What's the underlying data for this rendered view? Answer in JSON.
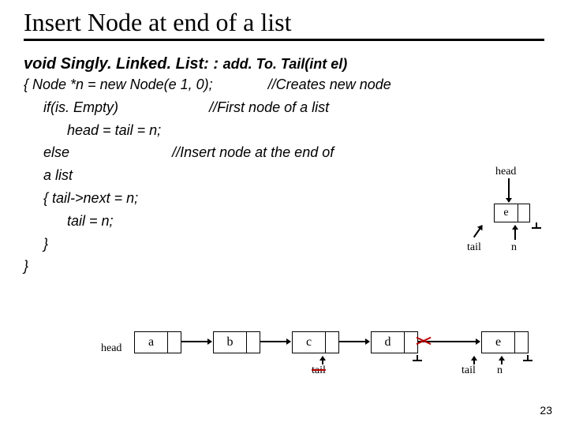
{
  "title": "Insert Node at end of a list",
  "signature": {
    "ret": "void ",
    "cls": "Singly. Linked. List: : ",
    "method": "add. To. Tail(int el)"
  },
  "lines": {
    "l1a": "{   Node *n = new Node(e 1, 0);",
    "l1b": "//Creates new node",
    "l2a": "if(is. Empty)",
    "l2b": "//First node of a list",
    "l3": "head = tail = n;",
    "l4a": "else",
    "l4b": "//Insert node at the end of",
    "l4c": "a list",
    "l5": "{    tail->next = n;",
    "l6": "tail = n;",
    "l7": "}",
    "l8": "}"
  },
  "dia1": {
    "head": "head",
    "val": "e",
    "tail": "tail",
    "n": "n"
  },
  "dia2": {
    "head": "head",
    "vals": [
      "a",
      "b",
      "c",
      "d",
      "e"
    ],
    "tail_old": "tail",
    "tail_new": "tail",
    "n": "n"
  },
  "pagenum": "23"
}
